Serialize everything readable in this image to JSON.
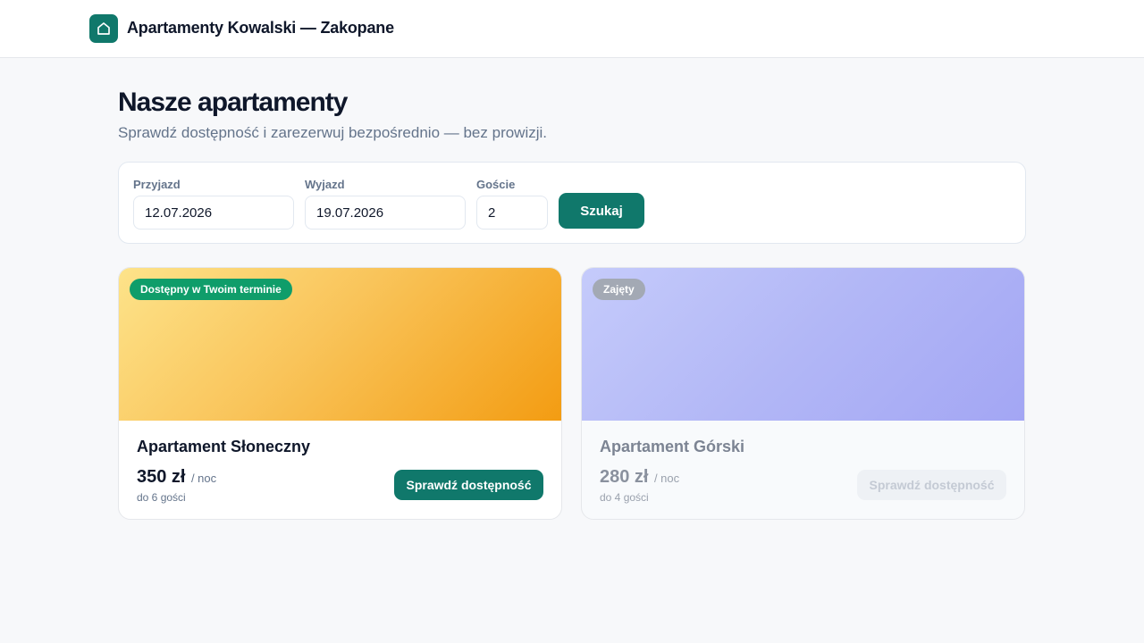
{
  "header": {
    "brand": "Apartamenty Kowalski — Zakopane",
    "logo_icon": "house-icon",
    "accent_color": "#10786b"
  },
  "hero": {
    "title": "Nasze apartamenty",
    "subtitle": "Sprawdź dostępność i zarezerwuj bezpośrednio — bez prowizji."
  },
  "search": {
    "arrival_label": "Przyjazd",
    "arrival_value": "12.07.2026",
    "departure_label": "Wyjazd",
    "departure_value": "19.07.2026",
    "guests_label": "Goście",
    "guests_value": "2",
    "button_label": "Szukaj"
  },
  "apartments": [
    {
      "badge": "Dostępny w Twoim terminie",
      "name": "Apartament Słoneczny",
      "price": "350 zł",
      "per_night": "/ noc",
      "guests": "do 6 gości",
      "button_label": "Sprawdź dostępność",
      "available": true
    },
    {
      "badge": "Zajęty",
      "name": "Apartament Górski",
      "price": "280 zł",
      "per_night": "/ noc",
      "guests": "do 4 gości",
      "button_label": "Sprawdź dostępność",
      "available": false
    }
  ]
}
